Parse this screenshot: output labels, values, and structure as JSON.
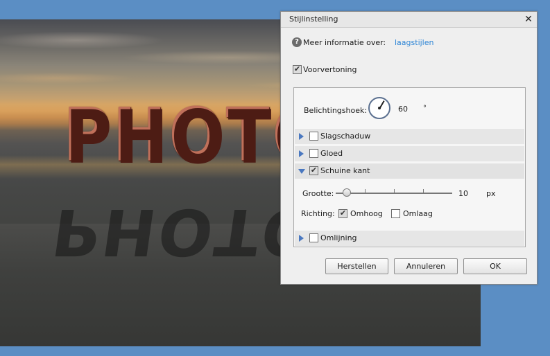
{
  "background": {
    "wordmark": "PHOTOS"
  },
  "dialog": {
    "title": "Stijlinstelling",
    "close_icon": "close-icon",
    "info": {
      "label": "Meer informatie over:",
      "link": "laagstijlen"
    },
    "preview": {
      "label": "Voorvertoning",
      "checked": true
    },
    "lighting": {
      "label": "Belichtingshoek:",
      "value": "60",
      "unit": "°",
      "angle_degrees": 60
    },
    "sections": {
      "slagschaduw": {
        "label": "Slagschaduw",
        "checked": false,
        "expanded": false
      },
      "gloed": {
        "label": "Gloed",
        "checked": false,
        "expanded": false
      },
      "schuine_kant": {
        "label": "Schuine kant",
        "checked": true,
        "expanded": true
      },
      "omlijning": {
        "label": "Omlijning",
        "checked": false,
        "expanded": false
      }
    },
    "bevel": {
      "size_label": "Grootte:",
      "size_value": "10",
      "size_unit": "px",
      "direction_label": "Richting:",
      "up_label": "Omhoog",
      "up_checked": true,
      "down_label": "Omlaag",
      "down_checked": false
    },
    "buttons": {
      "reset": "Herstellen",
      "cancel": "Annuleren",
      "ok": "OK"
    }
  }
}
